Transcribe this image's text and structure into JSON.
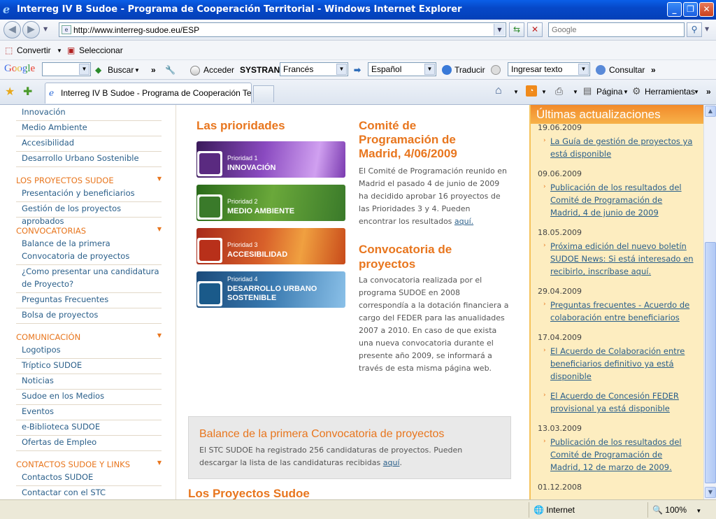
{
  "window": {
    "title": "Interreg IV B Sudoe - Programa de Cooperación Territorial - Windows Internet Explorer"
  },
  "address": {
    "url": "http://www.interreg-sudoe.eu/ESP"
  },
  "search": {
    "placeholder": "Google"
  },
  "toolbar1": {
    "convert": "Convertir",
    "select": "Seleccionar"
  },
  "toolbar2": {
    "google": "Google",
    "buscar": "Buscar",
    "acceder": "Acceder",
    "systran": "SYSTRAN",
    "from_lang": "Francés",
    "to_lang": "Español",
    "translate": "Traducir",
    "input_text": "Ingresar texto",
    "consult": "Consultar",
    "more": "»"
  },
  "tabs": {
    "active": "Interreg IV B Sudoe - Programa de Cooperación Territ...",
    "page_menu": "Página",
    "tools_menu": "Herramientas"
  },
  "leftnav": {
    "items_top": [
      "Innovación",
      "Medio Ambiente",
      "Accesibilidad",
      "Desarrollo Urbano Sostenible"
    ],
    "proyectos": {
      "head": "LOS PROYECTOS SUDOE",
      "items": [
        "Presentación y beneficiarios",
        "Gestión de los proyectos aprobados"
      ]
    },
    "convocatorias": {
      "head": "CONVOCATORIAS",
      "items": [
        "Balance de la primera Convocatoria de proyectos",
        "¿Como presentar una candidatura de Proyecto?",
        "Preguntas Frecuentes",
        "Bolsa de proyectos"
      ]
    },
    "comunicacion": {
      "head": "COMUNICACIÓN",
      "items": [
        "Logotipos",
        "Tríptico SUDOE",
        "Noticias",
        "Sudoe en los Medios",
        "Eventos",
        "e-Biblioteca SUDOE",
        "Ofertas de Empleo"
      ]
    },
    "contactos": {
      "head": "CONTACTOS SUDOE Y LINKS",
      "items": [
        "Contactos SUDOE",
        "Contactar con el STC"
      ]
    }
  },
  "prioridades": {
    "title": "Las prioridades",
    "items": [
      {
        "num": "Prioridad 1",
        "name": "INNOVACIÓN",
        "color": "#7b3fa0"
      },
      {
        "num": "Prioridad 2",
        "name": "MEDIO AMBIENTE",
        "color": "#4c8a2a"
      },
      {
        "num": "Prioridad 3",
        "name": "ACCESIBILIDAD",
        "color": "#c84a1a"
      },
      {
        "num": "Prioridad 4",
        "name1": "DESARROLLO URBANO",
        "name2": "SOSTENIBLE",
        "color": "#2a6a9a"
      }
    ]
  },
  "comite": {
    "title1": "Comité de",
    "title2": "Programación de",
    "title3": "Madrid, 4/06/2009",
    "body": "El Comité de Programación reunido en Madrid el pasado 4 de junio de 2009 ha decidido aprobar 16 proyectos de las Prioridades 3 y 4. Pueden encontrar los resultados",
    "link": "aquí."
  },
  "convocatoria": {
    "title1": "Convocatoria de",
    "title2": "proyectos",
    "body": "La convocatoria realizada por el programa SUDOE en 2008 correspondía a la dotación financiera a cargo del FEDER para las anualidades 2007 a 2010. En caso de que exista una nueva convocatoria durante el presente año 2009, se informará a través de esta misma página web."
  },
  "balance": {
    "title": "Balance de la primera Convocatoria de proyectos",
    "body": "El STC SUDOE ha registrado 256 candidaturas de proyectos. Pueden descargar la lista de las candidaturas recibidas",
    "link": "aquí",
    "tail": "."
  },
  "proyectos_sudoe": {
    "title": "Los Proyectos Sudoe"
  },
  "updates": {
    "title": "Últimas actualizaciones",
    "entries": [
      {
        "date": "19.06.2009",
        "items": [
          "La Guía de gestión de proyectos ya está disponible"
        ]
      },
      {
        "date": "09.06.2009",
        "items": [
          "Publicación de los resultados del Comité de Programación de Madrid, 4 de junio de 2009"
        ]
      },
      {
        "date": "18.05.2009",
        "items": [
          "Próxima edición del nuevo boletín SUDOE News: Si está interesado en recibirlo, inscríbase aquí."
        ]
      },
      {
        "date": "29.04.2009",
        "items": [
          "Preguntas frecuentes - Acuerdo de colaboración entre beneficiarios"
        ]
      },
      {
        "date": "17.04.2009",
        "items": [
          "El Acuerdo de Colaboración entre beneficiarios definitivo ya está disponible",
          "El Acuerdo de Concesión FEDER provisional ya está disponible"
        ]
      },
      {
        "date": "13.03.2009",
        "items": [
          "Publicación de los resultados del Comité de Programación de Madrid, 12 de marzo de 2009."
        ]
      },
      {
        "date": "01.12.2008",
        "items": []
      }
    ]
  },
  "status": {
    "zone": "Internet",
    "zoom": "100%"
  }
}
